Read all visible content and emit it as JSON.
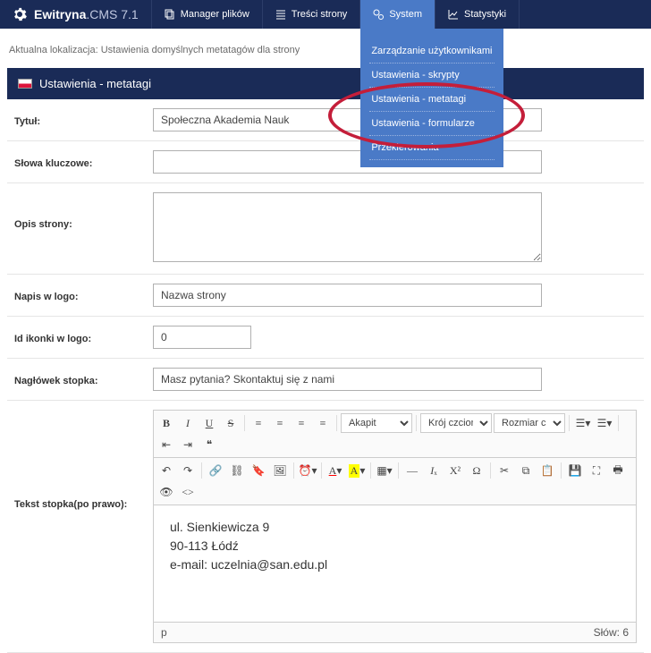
{
  "brand": {
    "name1": "Ewitryna",
    "name2": ".CMS 7.1"
  },
  "nav": {
    "files": "Manager plików",
    "content": "Treści strony",
    "system": "System",
    "stats": "Statystyki"
  },
  "dropdown": {
    "users": "Zarządzanie użytkownikami",
    "scripts": "Ustawienia - skrypty",
    "metatags": "Ustawienia - metatagi",
    "forms": "Ustawienia - formularze",
    "redirects": "Przekierowania"
  },
  "breadcrumb": "Aktualna lokalizacja: Ustawienia domyślnych metatagów dla strony",
  "section_title": "Ustawienia - metatagi",
  "labels": {
    "title": "Tytuł:",
    "keywords": "Słowa kluczowe:",
    "description": "Opis strony:",
    "logo_text": "Napis w logo:",
    "icon_id": "Id ikonki w logo:",
    "footer_header": "Nagłówek stopka:",
    "footer_text": "Tekst stopka(po prawo):"
  },
  "values": {
    "title": "Społeczna Akademia Nauk",
    "keywords": "",
    "description": "",
    "logo_text": "Nazwa strony",
    "icon_id": "0",
    "footer_header": "Masz pytania? Skontaktuj się z nami",
    "footer_line1": "ul. Sienkiewicza 9",
    "footer_line2": "90-113 Łódź",
    "footer_line3": "e-mail: uczelnia@san.edu.pl"
  },
  "editor": {
    "format": "Akapit",
    "font": "Krój czcionki",
    "size": "Rozmiar c...",
    "path": "p",
    "words_label": "Słów:",
    "words_count": "6"
  }
}
